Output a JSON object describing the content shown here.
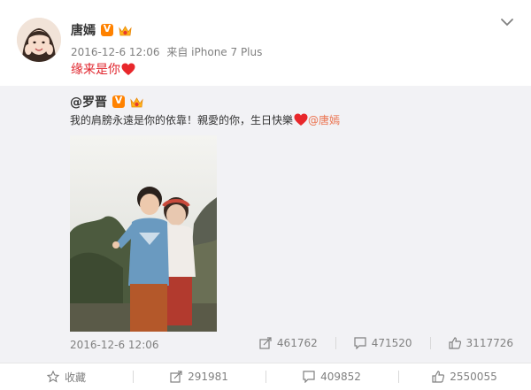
{
  "post": {
    "author": "唐嫣",
    "timestamp": "2016-12-6 12:06",
    "source_prefix": "来自",
    "source": "iPhone 7 Plus",
    "text": "缘来是你"
  },
  "repost": {
    "author": "@罗晋",
    "text": "我的肩膀永遠是你的依靠！親愛的你，生日快樂",
    "mention": "@唐嫣",
    "timestamp": "2016-12-6 12:06",
    "stats": {
      "reposts": "461762",
      "comments": "471520",
      "likes": "3117726"
    }
  },
  "actions": {
    "favorite": "收藏",
    "repost": "291981",
    "comment": "409852",
    "like": "2550055"
  },
  "colors": {
    "accent_red": "#e0242c",
    "mention": "#eb7350",
    "vip_orange": "#ff8200",
    "repost_bg": "#f2f2f5"
  },
  "icons": [
    "avatar",
    "verified-v-icon",
    "member-crown-icon",
    "heart-icon",
    "chevron-down-icon",
    "repost-icon",
    "comment-icon",
    "like-icon",
    "star-icon"
  ]
}
